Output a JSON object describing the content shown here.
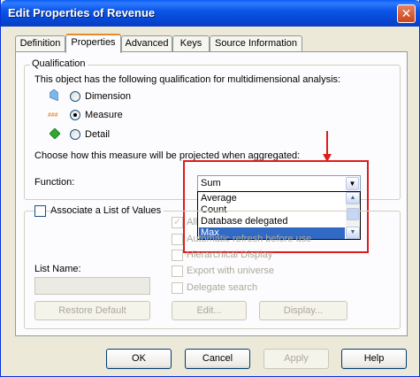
{
  "window": {
    "title": "Edit Properties of Revenue",
    "close_glyph": "✕"
  },
  "tabs": [
    {
      "label": "Definition",
      "mnemonic": ""
    },
    {
      "label": "Properties",
      "mnemonic": ""
    },
    {
      "label": "Advanced",
      "mnemonic": ""
    },
    {
      "label": "Keys",
      "mnemonic": ""
    },
    {
      "label": "Source Information",
      "mnemonic": ""
    }
  ],
  "qualification": {
    "legend": "Qualification",
    "description": "This object has the following qualification for multidimensional analysis:",
    "options": [
      {
        "label": "Dimension",
        "icon": "dimension-icon",
        "checked": false
      },
      {
        "label": "Measure",
        "icon": "measure-icon",
        "checked": true
      },
      {
        "label": "Detail",
        "icon": "detail-icon",
        "checked": false
      }
    ],
    "aggregation_prompt": "Choose how this measure will be projected when aggregated:",
    "function_label": "Function:",
    "function_value": "Sum",
    "function_options": [
      "Average",
      "Count",
      "Database delegated",
      "Max"
    ],
    "function_highlighted": "Max"
  },
  "lov": {
    "checkbox_label": "Associate a List of Values",
    "list_name_label": "List Name:",
    "list_name_value": "",
    "options": [
      {
        "label": "Allow users to edit this list of values",
        "checked": true
      },
      {
        "label": "Automatic refresh before use",
        "checked": false
      },
      {
        "label": "Hierarchical Display",
        "checked": false
      },
      {
        "label": "Export with universe",
        "checked": false
      },
      {
        "label": "Delegate search",
        "checked": false
      }
    ],
    "restore_default_label": "Restore Default",
    "edit_label": "Edit...",
    "display_label": "Display..."
  },
  "buttons": {
    "ok": "OK",
    "cancel": "Cancel",
    "apply": "Apply",
    "help": "Help"
  },
  "colors": {
    "highlight_red": "#e01b1b",
    "selection_blue": "#316ac5",
    "titlebar_blue": "#0645d2"
  }
}
